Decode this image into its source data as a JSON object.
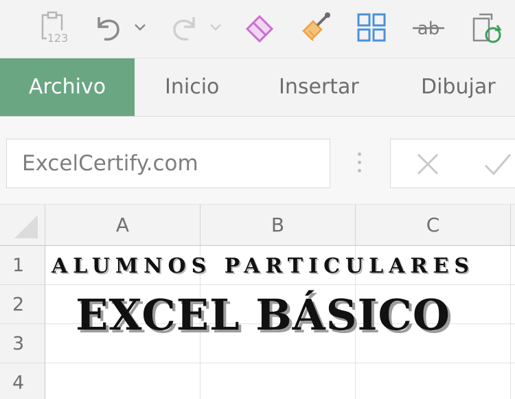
{
  "quick_access": {
    "icons": [
      "paste-values-icon",
      "undo-icon",
      "dropdown-icon",
      "redo-icon",
      "dropdown-icon",
      "eraser-icon",
      "format-painter-icon",
      "grid-layout-icon",
      "strikethrough-icon",
      "copy-refresh-icon"
    ],
    "paste_values_label": "123",
    "strikethrough_label": "ab"
  },
  "colors": {
    "active_tab": "#6aa682",
    "eraser": "#c96fd0",
    "format_painter": "#f0a040",
    "grid_icon": "#4a90d9",
    "refresh": "#3aa05a"
  },
  "ribbon": {
    "tabs": [
      {
        "label": "Archivo",
        "active": true
      },
      {
        "label": "Inicio",
        "active": false
      },
      {
        "label": "Insertar",
        "active": false
      },
      {
        "label": "Dibujar",
        "active": false
      }
    ]
  },
  "formula_bar": {
    "name_box": "ExcelCertify.com",
    "cancel_icon": "close-icon",
    "enter_icon": "check-icon"
  },
  "sheet": {
    "columns": [
      "A",
      "B",
      "C"
    ],
    "rows": [
      "1",
      "2",
      "3",
      "4"
    ]
  },
  "overlay": {
    "subtitle": "ALUMNOS PARTICULARES",
    "headline": "EXCEL BÁSICO"
  }
}
